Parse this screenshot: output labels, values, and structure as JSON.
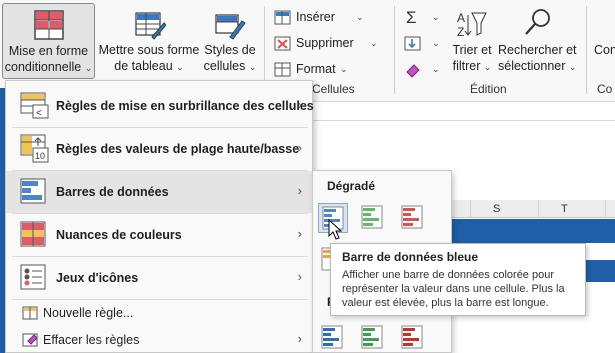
{
  "ribbon": {
    "conditional_format": {
      "line1": "Mise en forme",
      "line2": "conditionnelle",
      "chevron": "⌄"
    },
    "format_table": {
      "line1": "Mettre sous forme",
      "line2": "de tableau",
      "chevron": "⌄"
    },
    "cell_styles": {
      "line1": "Styles de",
      "line2": "cellules",
      "chevron": "⌄"
    },
    "cells_group": {
      "insert": "Insérer",
      "delete": "Supprimer",
      "format": "Format",
      "label": "Cellules"
    },
    "edit_group": {
      "sort_filter": {
        "line1": "Trier et",
        "line2": "filtrer"
      },
      "find_select": {
        "line1": "Rechercher et",
        "line2": "sélectionner"
      },
      "label": "Édition"
    },
    "partial_right": {
      "top": "Con",
      "bottom": "Co"
    }
  },
  "sheet": {
    "col_s": "S",
    "col_t": "T",
    "band_color": "#1f5fa8"
  },
  "menu": {
    "items": [
      {
        "label": "Règles de mise en surbrillance des cellules",
        "has_arrow": true
      },
      {
        "label": "Règles des valeurs de plage haute/basse",
        "has_arrow": true
      },
      {
        "label": "Barres de données",
        "has_arrow": true,
        "active": true
      },
      {
        "label": "Nuances de couleurs",
        "has_arrow": true
      },
      {
        "label": "Jeux d'icônes",
        "has_arrow": true
      },
      {
        "label": "Nouvelle règle...",
        "has_arrow": false
      },
      {
        "label": "Effacer les règles",
        "has_arrow": true
      }
    ],
    "arrow_glyph": "›"
  },
  "submenu": {
    "section_gradient": "Dégradé",
    "section_solid_initial": "R"
  },
  "tooltip": {
    "title": "Barre de données bleue",
    "body": "Afficher une barre de données colorée pour représenter la valeur dans une cellule. Plus la valeur est élevée, plus la barre est longue."
  },
  "colors": {
    "blue": "#4a86c8",
    "green": "#63b66e",
    "red": "#d9534f"
  }
}
